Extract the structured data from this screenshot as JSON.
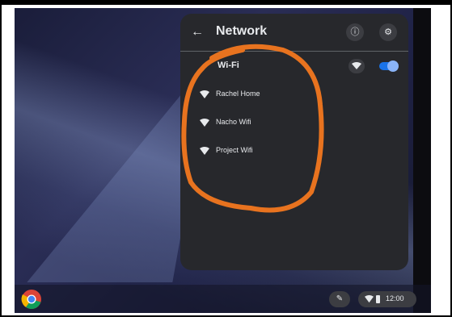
{
  "panel": {
    "back_icon": "arrow-left-icon",
    "title": "Network",
    "info_icon": "info-icon",
    "settings_icon": "gear-icon"
  },
  "wifi": {
    "label": "Wi-Fi",
    "settings_icon": "wifi-settings-icon",
    "enabled": true,
    "networks": [
      {
        "name": "Rachel Home",
        "icon": "wifi-signal-icon"
      },
      {
        "name": "Nacho Wifi",
        "icon": "wifi-signal-icon"
      },
      {
        "name": "Project Wifi",
        "icon": "wifi-signal-icon"
      }
    ]
  },
  "shelf": {
    "launcher_icon": "chrome-icon",
    "pen_icon": "stylus-icon",
    "time": "12:00"
  },
  "colors": {
    "panel_bg": "#27282c",
    "accent": "#1a73e8",
    "annotation": "#e8731f"
  }
}
